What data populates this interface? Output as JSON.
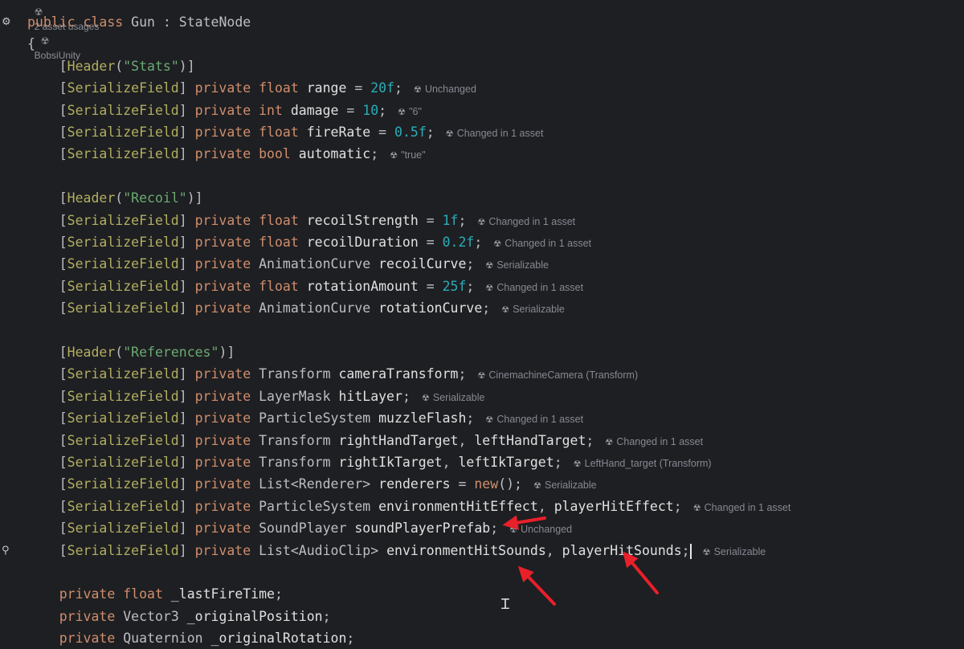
{
  "usages_bar": {
    "asset_usages": "2 asset usages",
    "author": "BobsiUnity"
  },
  "gutter_icons": {
    "class_icon": "gear-override-icon",
    "line_icon": "unity-asset-icon"
  },
  "hint_icon": "unity-asset-icon",
  "lines": [
    {
      "text": "public class Gun : StateNode",
      "hint": ""
    },
    {
      "text": "{",
      "hint": ""
    },
    {
      "text": "    [Header(\"Stats\")]",
      "hint": ""
    },
    {
      "text": "    [SerializeField] private float range = 20f;",
      "hint": "Unchanged"
    },
    {
      "text": "    [SerializeField] private int damage = 10;",
      "hint": "\"6\""
    },
    {
      "text": "    [SerializeField] private float fireRate = 0.5f;",
      "hint": "Changed in 1 asset"
    },
    {
      "text": "    [SerializeField] private bool automatic;",
      "hint": "\"true\""
    },
    {
      "text": "",
      "hint": ""
    },
    {
      "text": "    [Header(\"Recoil\")]",
      "hint": ""
    },
    {
      "text": "    [SerializeField] private float recoilStrength = 1f;",
      "hint": "Changed in 1 asset"
    },
    {
      "text": "    [SerializeField] private float recoilDuration = 0.2f;",
      "hint": "Changed in 1 asset"
    },
    {
      "text": "    [SerializeField] private AnimationCurve recoilCurve;",
      "hint": "Serializable"
    },
    {
      "text": "    [SerializeField] private float rotationAmount = 25f;",
      "hint": "Changed in 1 asset"
    },
    {
      "text": "    [SerializeField] private AnimationCurve rotationCurve;",
      "hint": "Serializable"
    },
    {
      "text": "",
      "hint": ""
    },
    {
      "text": "    [Header(\"References\")]",
      "hint": ""
    },
    {
      "text": "    [SerializeField] private Transform cameraTransform;",
      "hint": "CinemachineCamera (Transform)"
    },
    {
      "text": "    [SerializeField] private LayerMask hitLayer;",
      "hint": "Serializable"
    },
    {
      "text": "    [SerializeField] private ParticleSystem muzzleFlash;",
      "hint": "Changed in 1 asset"
    },
    {
      "text": "    [SerializeField] private Transform rightHandTarget, leftHandTarget;",
      "hint": "Changed in 1 asset"
    },
    {
      "text": "    [SerializeField] private Transform rightIkTarget, leftIkTarget;",
      "hint": "LeftHand_target (Transform)"
    },
    {
      "text": "    [SerializeField] private List<Renderer> renderers = new();",
      "hint": "Serializable"
    },
    {
      "text": "    [SerializeField] private ParticleSystem environmentHitEffect, playerHitEffect;",
      "hint": "Changed in 1 asset"
    },
    {
      "text": "    [SerializeField] private SoundPlayer soundPlayerPrefab;",
      "hint": "Unchanged"
    },
    {
      "text": "    [SerializeField] private List<AudioClip> environmentHitSounds, playerHitSounds;",
      "hint": "Serializable"
    },
    {
      "text": "",
      "hint": ""
    },
    {
      "text": "    private float _lastFireTime;",
      "hint": ""
    },
    {
      "text": "    private Vector3 _originalPosition;",
      "hint": ""
    },
    {
      "text": "    private Quaternion _originalRotation;",
      "hint": ""
    }
  ],
  "annotation_color": "#e8202a"
}
